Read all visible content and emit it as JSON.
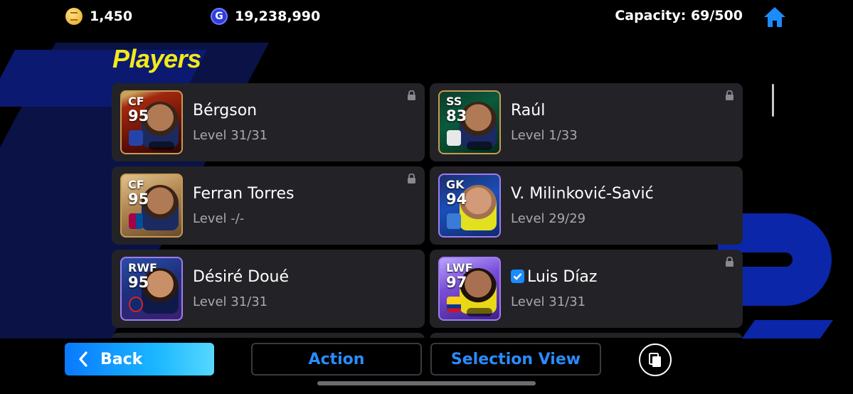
{
  "header": {
    "coins": "1,450",
    "gp": "19,238,990",
    "gp_icon_letter": "G",
    "capacity": "Capacity: 69/500"
  },
  "page_title": "Players",
  "players": [
    {
      "position": "CF",
      "rating": "95",
      "name": "Bérgson",
      "level": "Level 31/31",
      "locked": true,
      "verified": false
    },
    {
      "position": "SS",
      "rating": "83",
      "name": "Raúl",
      "level": "Level 1/33",
      "locked": true,
      "verified": false
    },
    {
      "position": "CF",
      "rating": "95",
      "name": "Ferran Torres",
      "level": "Level -/-",
      "locked": true,
      "verified": false
    },
    {
      "position": "GK",
      "rating": "94",
      "name": "V. Milinković-Savić",
      "level": "Level 29/29",
      "locked": false,
      "verified": false
    },
    {
      "position": "RWF",
      "rating": "95",
      "name": "Désiré Doué",
      "level": "Level 31/31",
      "locked": false,
      "verified": false
    },
    {
      "position": "LWF",
      "rating": "97",
      "name": "Luis Díaz",
      "level": "Level 31/31",
      "locked": true,
      "verified": true
    }
  ],
  "footer": {
    "back_label": "Back",
    "action_label": "Action",
    "selection_label": "Selection View"
  },
  "colors": {
    "accent_blue": "#2a8cff",
    "title_yellow": "#f3ea17",
    "card_bg": "#232327"
  }
}
